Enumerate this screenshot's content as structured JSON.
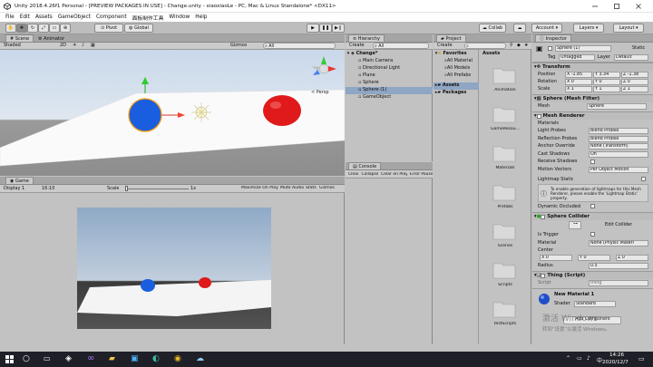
{
  "window": {
    "title": "Unity 2018.4.26f1 Personal - [PREVIEW PACKAGES IN USE] - Change.unity - xiaoxiaoLe - PC, Mac & Linux Standalone* <DX11>"
  },
  "menu": [
    "File",
    "Edit",
    "Assets",
    "GameObject",
    "Component",
    "面板制作工具",
    "Window",
    "Help"
  ],
  "toolbar": {
    "pivot": "Pivot",
    "global": "Global",
    "collab": "Collab",
    "account": "Account",
    "layers": "Layers",
    "layout": "Layout"
  },
  "scene": {
    "tabs": [
      "Scene",
      "Animator"
    ],
    "shading": "Shaded",
    "mode_2d": "2D",
    "gizmos": "Gizmos",
    "search": "All",
    "persp": "< Persp"
  },
  "game": {
    "tab": "Game",
    "display": "Display 1",
    "aspect": "16:10",
    "scale_label": "Scale",
    "scale_value": "1x",
    "options": [
      "Maximize On Play",
      "Mute Audio",
      "Stats",
      "Gizmos"
    ]
  },
  "hierarchy": {
    "tab": "Hierarchy",
    "create": "Create",
    "search": "All",
    "scene": "Change*",
    "items": [
      "Main Camera",
      "Directional Light",
      "Plane",
      "Sphere",
      "Sphere (1)",
      "GameObject"
    ]
  },
  "console": {
    "tab": "Console",
    "buttons": [
      "Clear",
      "Collapse",
      "Clear on Play",
      "Error Pause"
    ]
  },
  "project": {
    "tab": "Project",
    "create": "Create",
    "favorites": "Favorites",
    "fav_items": [
      "All Material",
      "All Models",
      "All Prefabs"
    ],
    "assets": "Assets",
    "packages": "Packages",
    "header": "Assets",
    "folders": [
      "Animation",
      "GameResou...",
      "Materials",
      "Prefabs",
      "Scenes",
      "Scripts",
      "testScripts"
    ]
  },
  "inspector": {
    "tab": "Inspector",
    "name": "Sphere (1)",
    "static": "Static",
    "tag_label": "Tag",
    "tag": "Untagged",
    "layer_label": "Layer",
    "layer": "Default",
    "transform": {
      "title": "Transform",
      "position_label": "Position",
      "position": [
        "X -1.85",
        "Y 3.34",
        "Z -1.38"
      ],
      "rotation_label": "Rotation",
      "rotation": [
        "X 0",
        "Y 0",
        "Z 0"
      ],
      "scale_label": "Scale",
      "scale": [
        "X 1",
        "Y 1",
        "Z 1"
      ]
    },
    "mesh_filter": {
      "title": "Sphere (Mesh Filter)",
      "mesh_label": "Mesh",
      "mesh": "Sphere"
    },
    "mesh_renderer": {
      "title": "Mesh Renderer",
      "materials": "Materials",
      "rows": [
        {
          "label": "Light Probes",
          "value": "Blend Probes"
        },
        {
          "label": "Reflection Probes",
          "value": "Blend Probes"
        },
        {
          "label": "Anchor Override",
          "value": "None (Transform)"
        },
        {
          "label": "Cast Shadows",
          "value": "On"
        },
        {
          "label": "Receive Shadows",
          "value": ""
        },
        {
          "label": "Motion Vectors",
          "value": "Per Object Motion"
        }
      ],
      "lightmap_static": "Lightmap Static",
      "info": "To enable generation of lightmaps for this Mesh Renderer, please enable the 'Lightmap Static' property.",
      "dynamic_occluded": "Dynamic Occluded"
    },
    "sphere_collider": {
      "title": "Sphere Collider",
      "edit_collider": "Edit Collider",
      "is_trigger": "Is Trigger",
      "material_label": "Material",
      "material": "None (Physic Materi",
      "center_label": "Center",
      "center": [
        "X 0",
        "Y 0",
        "Z 0"
      ],
      "radius_label": "Radius",
      "radius": "0.5"
    },
    "script": {
      "title": "Thing (Script)",
      "script_label": "Script",
      "script": "thing"
    },
    "material": {
      "name": "New Material 1",
      "shader_label": "Shader",
      "shader": "Standard"
    },
    "add_component": "Add Component"
  },
  "watermark": {
    "line1": "激活 Windows",
    "line2": "转到“设置”以激活 Windows。"
  },
  "taskbar": {
    "time": "14:26",
    "date": "2020/12/7",
    "ime": "中"
  },
  "colors": {
    "ball_red": "#e01a1a",
    "ball_blue": "#1a5ee0",
    "taskbar": "#1f1f28",
    "panel": "#c2c2c2"
  }
}
